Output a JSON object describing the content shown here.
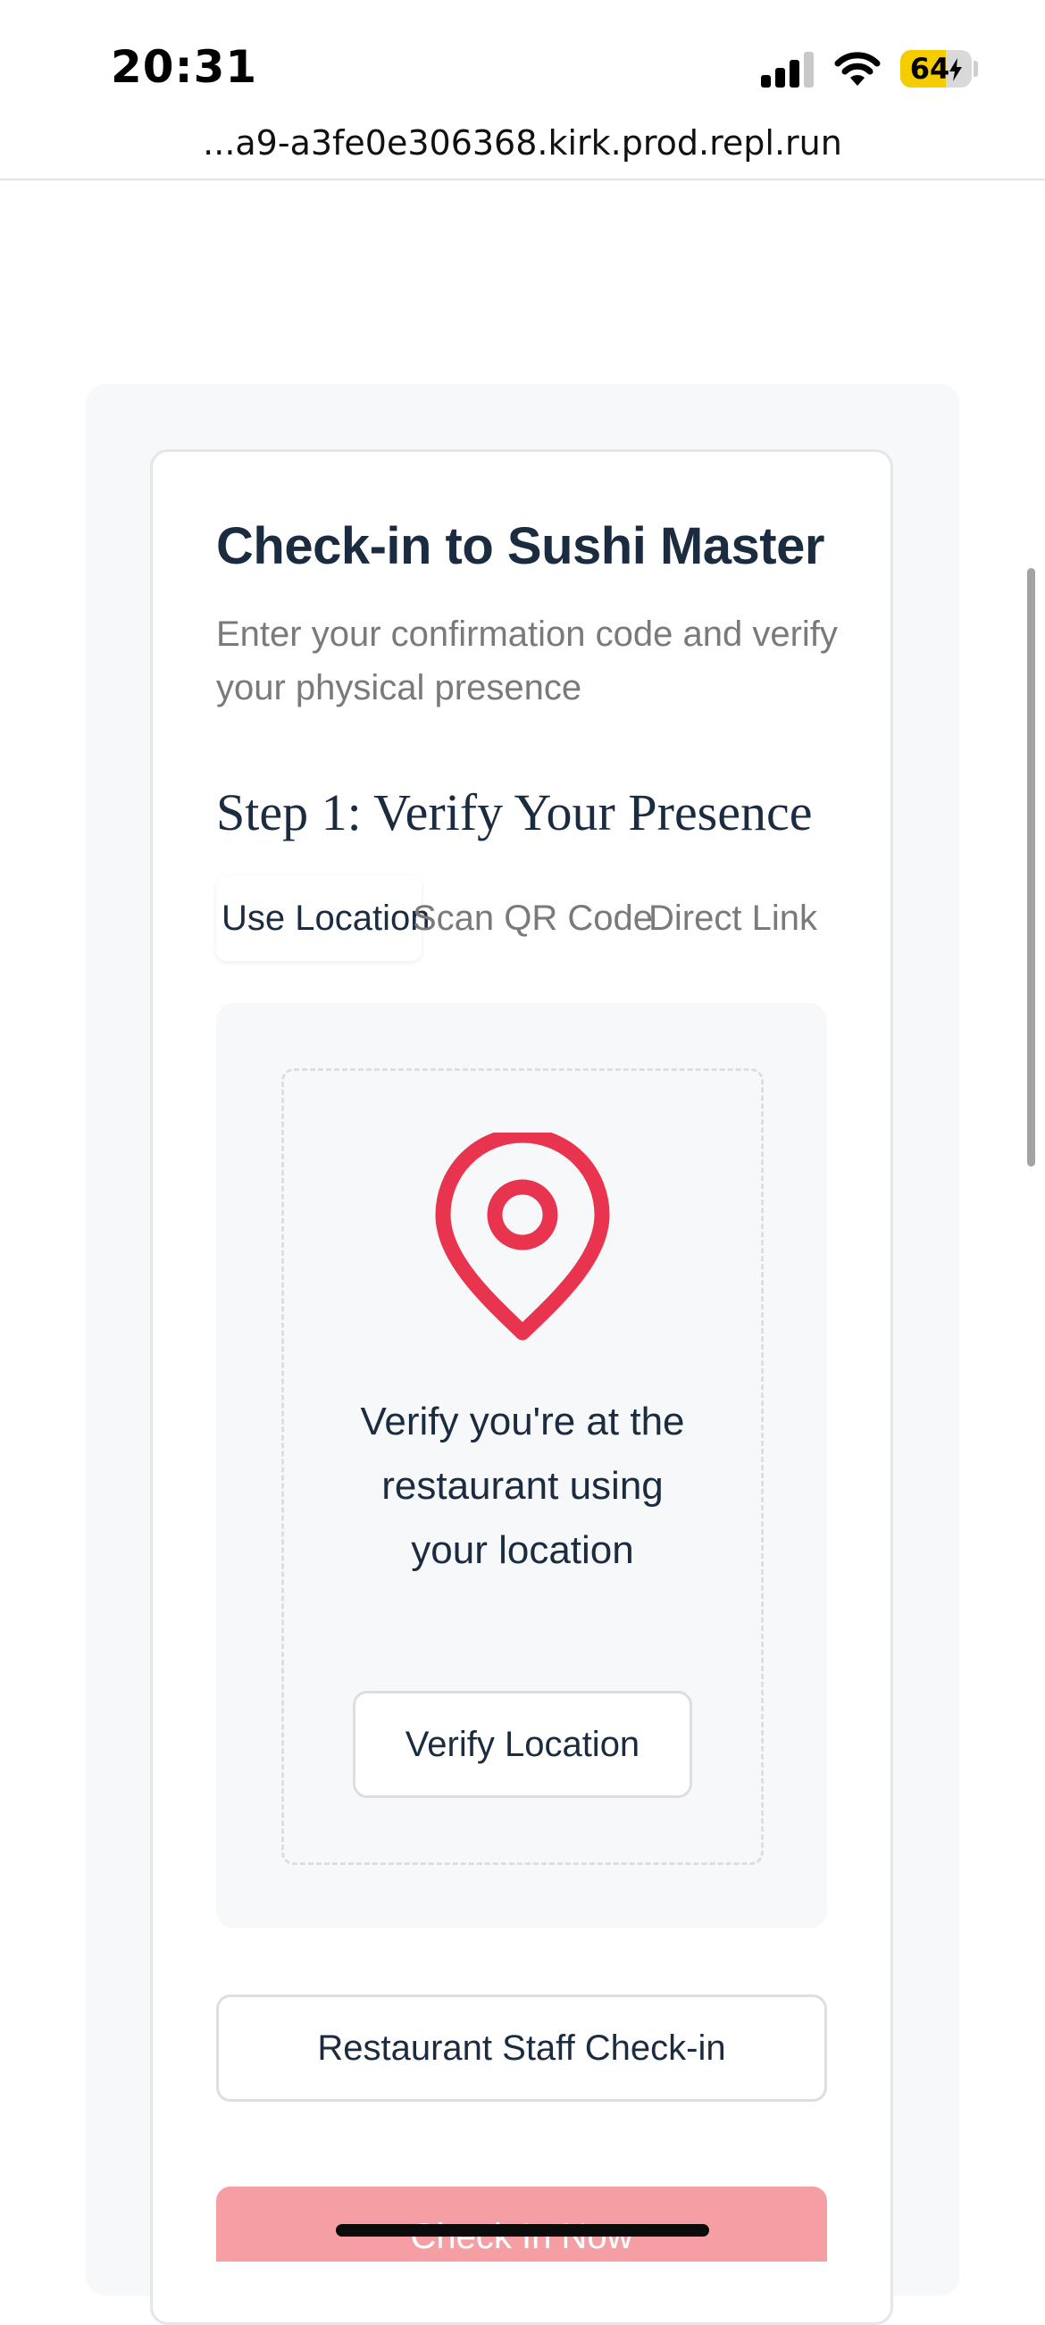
{
  "status_bar": {
    "time": "20:31",
    "battery_level": "64",
    "battery_fraction": 0.64,
    "signal_icon": "cellular-signal-icon",
    "wifi_icon": "wifi-icon",
    "charging_icon": "bolt-icon"
  },
  "browser": {
    "url": "...a9-a3fe0e306368.kirk.prod.repl.run"
  },
  "checkin": {
    "title": "Check-in to Sushi Master",
    "subtitle": "Enter your confirmation code and verify your physical presence",
    "step_heading": "Step 1: Verify Your Presence",
    "tabs": [
      {
        "label": "Use Location",
        "active": true
      },
      {
        "label": "Scan QR Code",
        "active": false
      },
      {
        "label": "Direct Link",
        "active": false
      }
    ],
    "location": {
      "icon": "map-pin-icon",
      "description": "Verify you're at the restaurant using your location",
      "button_label": "Verify Location"
    },
    "staff_button_label": "Restaurant Staff Check-in",
    "checkin_button_label": "Check In Now"
  },
  "colors": {
    "accent": "#e8344e",
    "heading": "#1b2b40",
    "muted": "#7a7a7a",
    "checkin_button_disabled": "#f59ea4"
  }
}
